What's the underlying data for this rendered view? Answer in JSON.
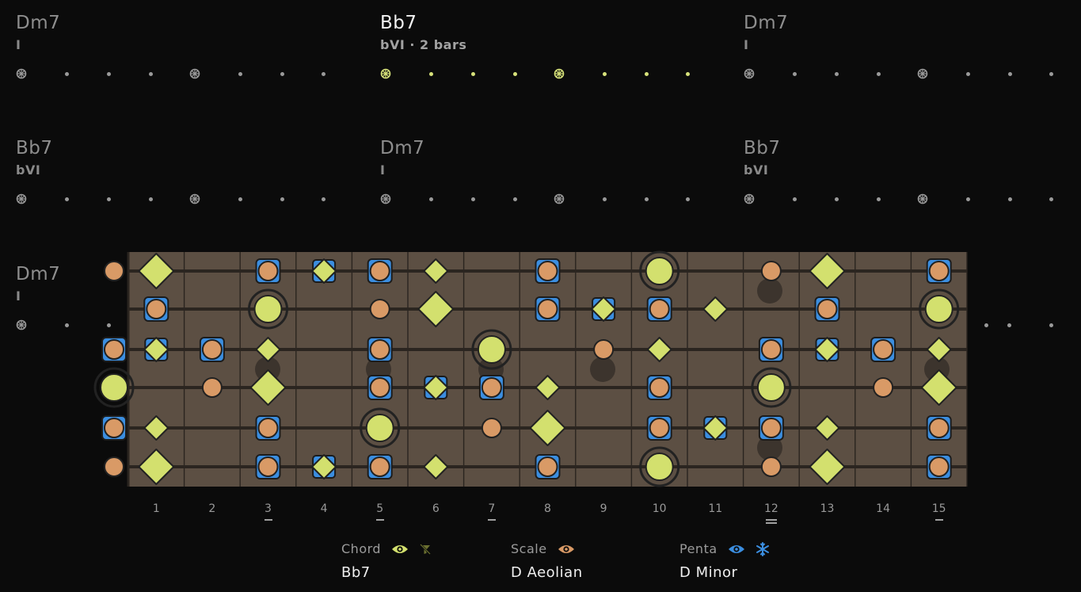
{
  "colors": {
    "chord": "#d3e06e",
    "scale": "#d99a66",
    "penta": "#3b8ee0",
    "fretboard": "#5c4f43",
    "background": "#0b0b0b"
  },
  "progression": [
    {
      "chord": "Dm7",
      "roman": "I",
      "active": false
    },
    {
      "chord": "Bb7",
      "roman": "bVI · 2 bars",
      "active": true
    },
    {
      "chord": "Dm7",
      "roman": "I",
      "active": false
    },
    {
      "chord": "Bb7",
      "roman": "bVI",
      "active": false
    },
    {
      "chord": "Dm7",
      "roman": "I",
      "active": false
    },
    {
      "chord": "Bb7",
      "roman": "bVI",
      "active": false
    },
    {
      "chord": "Dm7",
      "roman": "I",
      "active": false
    }
  ],
  "fretboard": {
    "fret_numbers": [
      "1",
      "2",
      "3",
      "4",
      "5",
      "6",
      "7",
      "8",
      "9",
      "10",
      "11",
      "12",
      "13",
      "14",
      "15"
    ],
    "marked_frets": [
      3,
      5,
      7,
      12,
      15
    ]
  },
  "controls": {
    "chord": {
      "label": "Chord",
      "value": "Bb7",
      "icons": [
        "eye-icon",
        "filter-off-icon"
      ]
    },
    "scale": {
      "label": "Scale",
      "value": "D Aeolian",
      "icons": [
        "eye-icon"
      ]
    },
    "penta": {
      "label": "Penta",
      "value": "D Minor",
      "icons": [
        "eye-icon",
        "snowflake-icon"
      ]
    }
  }
}
